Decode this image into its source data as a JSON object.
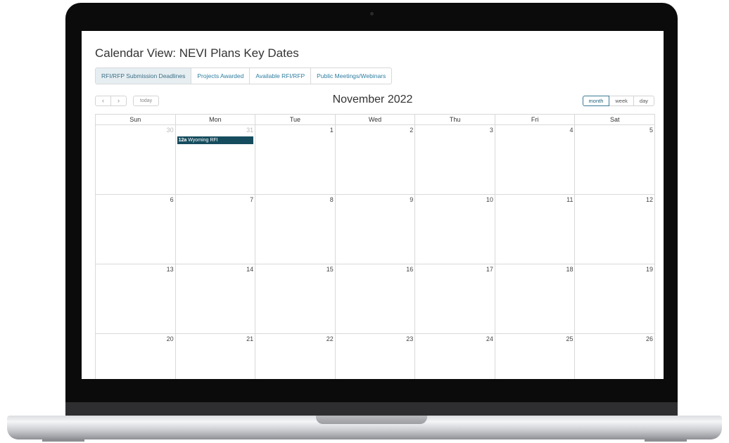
{
  "page_title": "Calendar View: NEVI Plans Key Dates",
  "tabs": [
    {
      "label": "RFI/RFP Submission Deadlines",
      "active": true
    },
    {
      "label": "Projects Awarded"
    },
    {
      "label": "Available RFI/RFP"
    },
    {
      "label": "Public Meetings/Webinars"
    }
  ],
  "toolbar": {
    "prev_label": "‹",
    "next_label": "›",
    "today_label": "today",
    "month_title": "November 2022",
    "views": [
      "month",
      "week",
      "day"
    ],
    "active_view": "month"
  },
  "calendar": {
    "weekdays": [
      "Sun",
      "Mon",
      "Tue",
      "Wed",
      "Thu",
      "Fri",
      "Sat"
    ],
    "weeks": [
      [
        {
          "d": "30",
          "other": true
        },
        {
          "d": "31",
          "other": true
        },
        {
          "d": "1"
        },
        {
          "d": "2"
        },
        {
          "d": "3"
        },
        {
          "d": "4"
        },
        {
          "d": "5"
        }
      ],
      [
        {
          "d": "6"
        },
        {
          "d": "7"
        },
        {
          "d": "8"
        },
        {
          "d": "9"
        },
        {
          "d": "10"
        },
        {
          "d": "11"
        },
        {
          "d": "12"
        }
      ],
      [
        {
          "d": "13"
        },
        {
          "d": "14"
        },
        {
          "d": "15"
        },
        {
          "d": "16"
        },
        {
          "d": "17"
        },
        {
          "d": "18"
        },
        {
          "d": "19"
        }
      ],
      [
        {
          "d": "20"
        },
        {
          "d": "21"
        },
        {
          "d": "22"
        },
        {
          "d": "23"
        },
        {
          "d": "24"
        },
        {
          "d": "25"
        },
        {
          "d": "26"
        }
      ]
    ],
    "events": [
      {
        "week": 0,
        "day": 1,
        "time": "12a",
        "title": "Wyoming RFI",
        "color": "#164d5e"
      }
    ]
  },
  "colors": {
    "accent": "#2e7ea0",
    "event": "#164d5e"
  }
}
